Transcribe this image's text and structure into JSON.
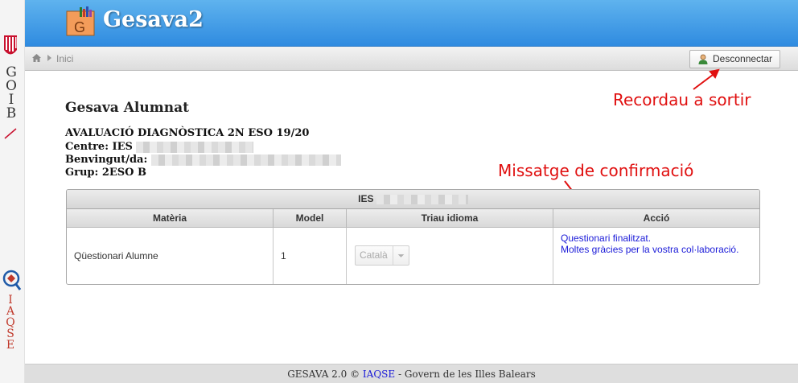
{
  "sidebar": {
    "goib_letters": [
      "G",
      "O",
      "I",
      "B"
    ],
    "iaqse_letters": [
      "I",
      "A",
      "Q",
      "S",
      "E"
    ]
  },
  "header": {
    "logo_letter": "G",
    "title": "Gesava2"
  },
  "breadcrumb": {
    "home_icon": "home-icon",
    "current": "Inici"
  },
  "toolbar": {
    "logout_label": "Desconnectar",
    "logout_icon": "user-icon"
  },
  "annotations": {
    "logout_hint": "Recordau a sortir",
    "confirmation_hint": "Missatge de confirmació"
  },
  "main": {
    "heading": "Gesava Alumnat",
    "evaluation": "AVALUACIÓ DIAGNÒSTICA 2N ESO 19/20",
    "centre_label": "Centre: IES",
    "welcome_label": "Benvingut/da:",
    "group_label": "Grup: 2ESO B"
  },
  "table": {
    "caption": "IES",
    "columns": [
      "Matèria",
      "Model",
      "Triau idioma",
      "Acció"
    ],
    "rows": [
      {
        "subject": "Qüestionari Alumne",
        "model": "1",
        "language": "Català",
        "message_line1": "Questionari finalitzat.",
        "message_line2": "Moltes gràcies per la vostra col·laboració."
      }
    ]
  },
  "footer": {
    "prefix": "GESAVA 2.0 ©",
    "link": "IAQSE",
    "suffix": "- Govern de les Illes Balears"
  },
  "colors": {
    "header_blue": "#2f8be0",
    "annotation_red": "#e01010",
    "message_blue": "#1a1ad8"
  }
}
